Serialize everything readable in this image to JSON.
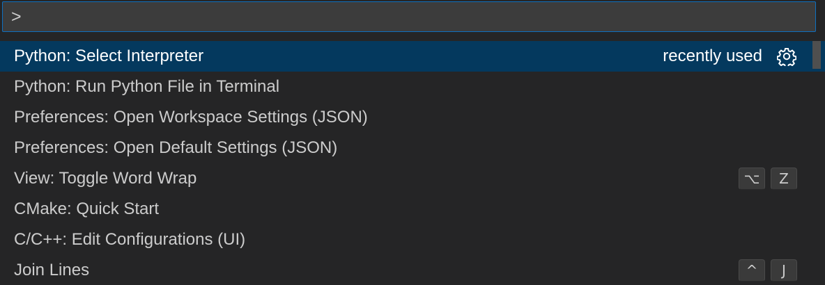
{
  "input": {
    "value": ">"
  },
  "items": [
    {
      "label": "Python: Select Interpreter",
      "detail": "recently used",
      "icon": "gear-icon",
      "keys": []
    },
    {
      "label": "Python: Run Python File in Terminal",
      "detail": "",
      "keys": []
    },
    {
      "label": "Preferences: Open Workspace Settings (JSON)",
      "detail": "",
      "keys": []
    },
    {
      "label": "Preferences: Open Default Settings (JSON)",
      "detail": "",
      "keys": []
    },
    {
      "label": "View: Toggle Word Wrap",
      "detail": "",
      "keys": [
        "⌥",
        "Z"
      ]
    },
    {
      "label": "CMake: Quick Start",
      "detail": "",
      "keys": []
    },
    {
      "label": "C/C++: Edit Configurations (UI)",
      "detail": "",
      "keys": []
    },
    {
      "label": "Join Lines",
      "detail": "",
      "keys": [
        "^",
        "J"
      ]
    }
  ],
  "colors": {
    "selected_bg": "#04395e",
    "focus_border": "#0e70c0",
    "background": "#252526"
  }
}
